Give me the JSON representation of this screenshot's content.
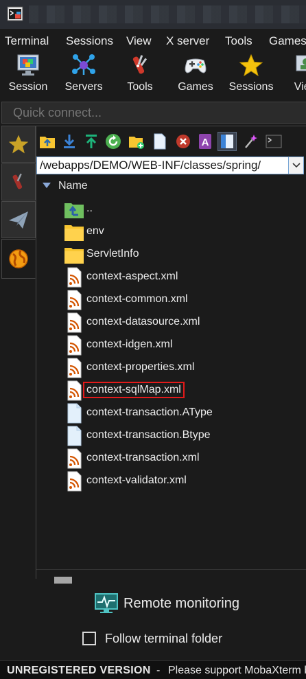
{
  "menu": [
    "Terminal",
    "Sessions",
    "View",
    "X server",
    "Tools",
    "Games"
  ],
  "toolbar": [
    {
      "label": "Session",
      "icon": "session-icon"
    },
    {
      "label": "Servers",
      "icon": "servers-icon"
    },
    {
      "label": "Tools",
      "icon": "tools-icon"
    },
    {
      "label": "Games",
      "icon": "gamepad-icon"
    },
    {
      "label": "Sessions",
      "icon": "star-icon"
    },
    {
      "label": "View",
      "icon": "view-icon"
    }
  ],
  "quick_connect": {
    "placeholder": "Quick connect..."
  },
  "sidebar_tabs": [
    "sessions-star-tab",
    "tools-tab",
    "macros-tab",
    "sftp-tab"
  ],
  "sftp": {
    "path": "/webapps/DEMO/WEB-INF/classes/spring/",
    "column_header": "Name",
    "files": [
      {
        "name": "..",
        "type": "parent"
      },
      {
        "name": "env",
        "type": "folder"
      },
      {
        "name": "ServletInfo",
        "type": "folder"
      },
      {
        "name": "context-aspect.xml",
        "type": "xml"
      },
      {
        "name": "context-common.xml",
        "type": "xml"
      },
      {
        "name": "context-datasource.xml",
        "type": "xml"
      },
      {
        "name": "context-idgen.xml",
        "type": "xml"
      },
      {
        "name": "context-properties.xml",
        "type": "xml"
      },
      {
        "name": "context-sqlMap.xml",
        "type": "xml",
        "highlighted": true
      },
      {
        "name": "context-transaction.AType",
        "type": "file"
      },
      {
        "name": "context-transaction.Btype",
        "type": "file"
      },
      {
        "name": "context-transaction.xml",
        "type": "xml"
      },
      {
        "name": "context-validator.xml",
        "type": "xml"
      }
    ]
  },
  "remote_monitoring": "Remote monitoring",
  "follow_terminal_folder": {
    "label": "Follow terminal folder",
    "checked": false
  },
  "status": {
    "unregistered": "UNREGISTERED VERSION",
    "dash": "-",
    "message": "Please support MobaXterm b"
  },
  "colors": {
    "highlight": "#e31a1a",
    "folder": "#f7c531",
    "xml": "#d35400"
  }
}
